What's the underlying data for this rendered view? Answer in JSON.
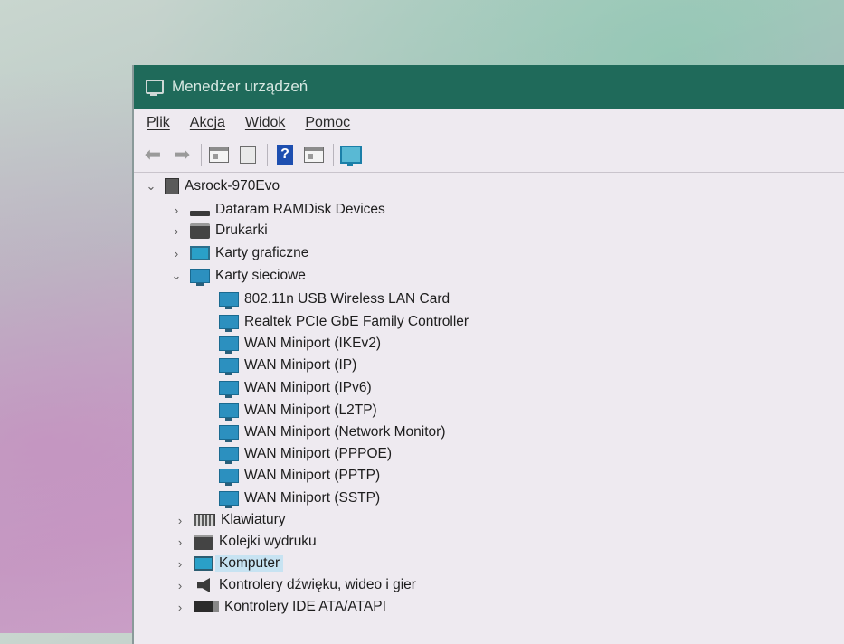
{
  "window": {
    "title": "Menedżer urządzeń"
  },
  "menu": {
    "items": [
      "Plik",
      "Akcja",
      "Widok",
      "Pomoc"
    ]
  },
  "toolbar": {
    "buttons": [
      "back-arrow-icon",
      "forward-arrow-icon",
      "properties-pane-icon",
      "sheet-icon",
      "help-icon",
      "view-pane-icon",
      "scan-monitor-icon"
    ]
  },
  "tree": {
    "root": "Asrock-970Evo",
    "categories": [
      {
        "label": "Dataram RAMDisk Devices",
        "icon": "disk-icon",
        "expanded": false
      },
      {
        "label": "Drukarki",
        "icon": "printer-icon",
        "expanded": false
      },
      {
        "label": "Karty graficzne",
        "icon": "monitor-icon",
        "expanded": false
      },
      {
        "label": "Karty sieciowe",
        "icon": "network-adapter-icon",
        "expanded": true,
        "children": [
          "802.11n USB Wireless LAN Card",
          "Realtek PCIe GbE Family Controller",
          "WAN Miniport (IKEv2)",
          "WAN Miniport (IP)",
          "WAN Miniport (IPv6)",
          "WAN Miniport (L2TP)",
          "WAN Miniport (Network Monitor)",
          "WAN Miniport (PPPOE)",
          "WAN Miniport (PPTP)",
          "WAN Miniport (SSTP)"
        ]
      },
      {
        "label": "Klawiatury",
        "icon": "keyboard-icon",
        "expanded": false
      },
      {
        "label": "Kolejki wydruku",
        "icon": "printer-icon",
        "expanded": false
      },
      {
        "label": "Komputer",
        "icon": "computer-icon",
        "expanded": false,
        "selected": true
      },
      {
        "label": "Kontrolery dźwięku, wideo i gier",
        "icon": "speaker-icon",
        "expanded": false
      },
      {
        "label": "Kontrolery IDE ATA/ATAPI",
        "icon": "ide-controller-icon",
        "expanded": false
      }
    ]
  },
  "colors": {
    "titlebar": "#1f6a5a",
    "selection": "#c7e3f2",
    "network_icon": "#2c90bf"
  }
}
